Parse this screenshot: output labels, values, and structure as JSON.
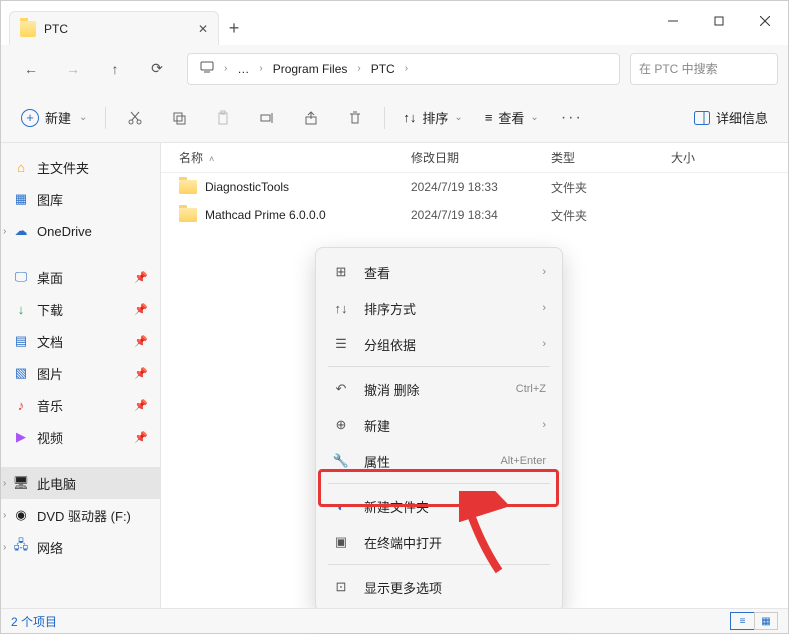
{
  "tab": {
    "title": "PTC"
  },
  "breadcrumb": {
    "seg1": "Program Files",
    "seg2": "PTC",
    "ellipsis": "…"
  },
  "search": {
    "placeholder": "在 PTC 中搜索"
  },
  "toolbar": {
    "new_label": "新建",
    "sort_label": "排序",
    "view_label": "查看",
    "details_label": "详细信息"
  },
  "sidebar": {
    "home": "主文件夹",
    "gallery": "图库",
    "onedrive": "OneDrive",
    "desktop": "桌面",
    "downloads": "下载",
    "documents": "文档",
    "pictures": "图片",
    "music": "音乐",
    "videos": "视频",
    "thispc": "此电脑",
    "dvd": "DVD 驱动器 (F:)",
    "network": "网络"
  },
  "columns": {
    "name": "名称",
    "date": "修改日期",
    "type": "类型",
    "size": "大小"
  },
  "rows": [
    {
      "name": "DiagnosticTools",
      "date": "2024/7/19 18:33",
      "type": "文件夹"
    },
    {
      "name": "Mathcad Prime 6.0.0.0",
      "date": "2024/7/19 18:34",
      "type": "文件夹"
    }
  ],
  "context_menu": {
    "view": "查看",
    "sort": "排序方式",
    "group": "分组依据",
    "undo": "撤消 删除",
    "undo_hint": "Ctrl+Z",
    "new": "新建",
    "properties": "属性",
    "properties_hint": "Alt+Enter",
    "new_folder": "新建文件夹",
    "terminal": "在终端中打开",
    "more": "显示更多选项"
  },
  "status": {
    "count": "2 个项目"
  }
}
